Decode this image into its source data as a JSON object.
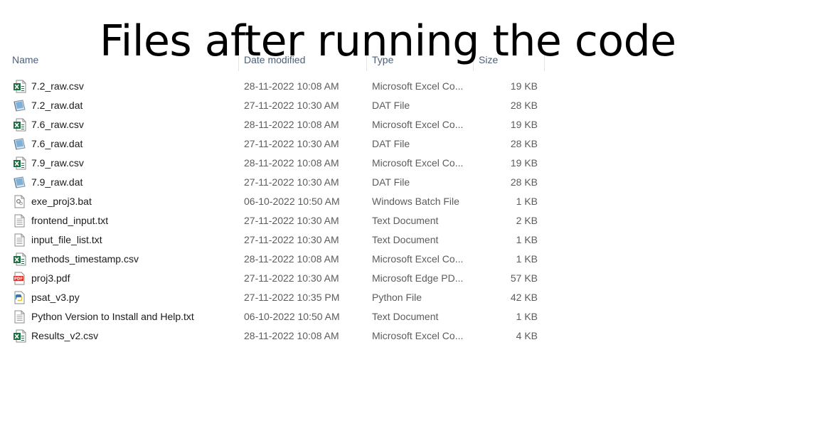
{
  "overlay_title": "Files after running the code",
  "columns": {
    "name": "Name",
    "date": "Date modified",
    "type": "Type",
    "size": "Size"
  },
  "files": [
    {
      "name": "7.2_raw.csv",
      "date": "28-11-2022 10:08 AM",
      "type": "Microsoft Excel Co...",
      "size": "19 KB",
      "icon": "excel-csv-icon"
    },
    {
      "name": "7.2_raw.dat",
      "date": "27-11-2022 10:30 AM",
      "type": "DAT File",
      "size": "28 KB",
      "icon": "dat-file-icon"
    },
    {
      "name": "7.6_raw.csv",
      "date": "28-11-2022 10:08 AM",
      "type": "Microsoft Excel Co...",
      "size": "19 KB",
      "icon": "excel-csv-icon"
    },
    {
      "name": "7.6_raw.dat",
      "date": "27-11-2022 10:30 AM",
      "type": "DAT File",
      "size": "28 KB",
      "icon": "dat-file-icon"
    },
    {
      "name": "7.9_raw.csv",
      "date": "28-11-2022 10:08 AM",
      "type": "Microsoft Excel Co...",
      "size": "19 KB",
      "icon": "excel-csv-icon"
    },
    {
      "name": "7.9_raw.dat",
      "date": "27-11-2022 10:30 AM",
      "type": "DAT File",
      "size": "28 KB",
      "icon": "dat-file-icon"
    },
    {
      "name": "exe_proj3.bat",
      "date": "06-10-2022 10:50 AM",
      "type": "Windows Batch File",
      "size": "1 KB",
      "icon": "batch-file-icon"
    },
    {
      "name": "frontend_input.txt",
      "date": "27-11-2022 10:30 AM",
      "type": "Text Document",
      "size": "2 KB",
      "icon": "text-file-icon"
    },
    {
      "name": "input_file_list.txt",
      "date": "27-11-2022 10:30 AM",
      "type": "Text Document",
      "size": "1 KB",
      "icon": "text-file-icon"
    },
    {
      "name": "methods_timestamp.csv",
      "date": "28-11-2022 10:08 AM",
      "type": "Microsoft Excel Co...",
      "size": "1 KB",
      "icon": "excel-csv-icon"
    },
    {
      "name": "proj3.pdf",
      "date": "27-11-2022 10:30 AM",
      "type": "Microsoft Edge PD...",
      "size": "57 KB",
      "icon": "pdf-file-icon"
    },
    {
      "name": "psat_v3.py",
      "date": "27-11-2022 10:35 PM",
      "type": "Python File",
      "size": "42 KB",
      "icon": "python-file-icon"
    },
    {
      "name": "Python Version to Install and Help.txt",
      "date": "06-10-2022 10:50 AM",
      "type": "Text Document",
      "size": "1 KB",
      "icon": "text-file-icon"
    },
    {
      "name": "Results_v2.csv",
      "date": "28-11-2022 10:08 AM",
      "type": "Microsoft Excel Co...",
      "size": "4 KB",
      "icon": "excel-csv-icon"
    }
  ],
  "icon_colors": {
    "excel": "#1d6f42",
    "pdf": "#d9342b",
    "python_blue": "#3776ab",
    "python_yellow": "#ffd43b",
    "text": "#8a8a8a"
  },
  "column_header_color": "#4c607a"
}
